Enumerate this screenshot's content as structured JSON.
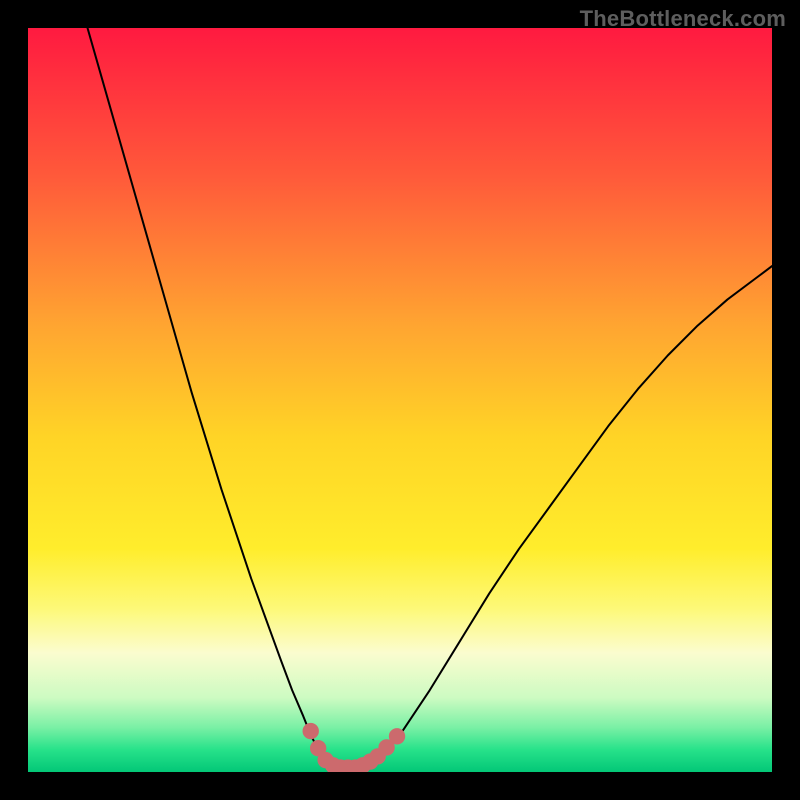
{
  "watermark": "TheBottleneck.com",
  "chart_data": {
    "type": "line",
    "title": "",
    "xlabel": "",
    "ylabel": "",
    "xlim": [
      0,
      100
    ],
    "ylim": [
      0,
      100
    ],
    "grid": false,
    "legend": false,
    "background_gradient": {
      "direction": "vertical",
      "stops": [
        {
          "pos": 0.0,
          "color": "#ff1a40"
        },
        {
          "pos": 0.2,
          "color": "#ff5a3a"
        },
        {
          "pos": 0.4,
          "color": "#ffa531"
        },
        {
          "pos": 0.55,
          "color": "#ffd426"
        },
        {
          "pos": 0.7,
          "color": "#ffed2c"
        },
        {
          "pos": 0.78,
          "color": "#fdf978"
        },
        {
          "pos": 0.84,
          "color": "#fbfccf"
        },
        {
          "pos": 0.9,
          "color": "#cdfbc2"
        },
        {
          "pos": 0.94,
          "color": "#7af0a5"
        },
        {
          "pos": 0.97,
          "color": "#27e28a"
        },
        {
          "pos": 1.0,
          "color": "#03c777"
        }
      ]
    },
    "series": [
      {
        "name": "left-curve",
        "color": "#000000",
        "x": [
          8,
          10,
          12,
          14,
          16,
          18,
          20,
          22,
          24,
          26,
          28,
          30,
          32,
          34,
          35.5,
          37,
          38,
          39,
          40
        ],
        "y": [
          100,
          93,
          86,
          79,
          72,
          65,
          58,
          51,
          44.5,
          38,
          32,
          26,
          20.5,
          15,
          11,
          7.5,
          5,
          3,
          1.5
        ]
      },
      {
        "name": "valley-floor",
        "color": "#000000",
        "x": [
          40,
          41,
          42,
          43,
          44,
          45,
          46,
          47
        ],
        "y": [
          1.5,
          0.8,
          0.5,
          0.5,
          0.5,
          0.8,
          1.3,
          2.0
        ]
      },
      {
        "name": "right-curve",
        "color": "#000000",
        "x": [
          47,
          50,
          54,
          58,
          62,
          66,
          70,
          74,
          78,
          82,
          86,
          90,
          94,
          98,
          100
        ],
        "y": [
          2.0,
          5,
          11,
          17.5,
          24,
          30,
          35.5,
          41,
          46.5,
          51.5,
          56,
          60,
          63.5,
          66.5,
          68
        ]
      }
    ],
    "markers": {
      "name": "valley-markers",
      "color": "#cc6a6d",
      "radius": 1.1,
      "points": [
        {
          "x": 38.0,
          "y": 5.5
        },
        {
          "x": 39.0,
          "y": 3.2
        },
        {
          "x": 40.0,
          "y": 1.6
        },
        {
          "x": 41.0,
          "y": 0.9
        },
        {
          "x": 42.0,
          "y": 0.6
        },
        {
          "x": 43.0,
          "y": 0.6
        },
        {
          "x": 44.0,
          "y": 0.6
        },
        {
          "x": 45.0,
          "y": 0.9
        },
        {
          "x": 46.0,
          "y": 1.4
        },
        {
          "x": 47.0,
          "y": 2.1
        },
        {
          "x": 48.2,
          "y": 3.3
        },
        {
          "x": 49.6,
          "y": 4.8
        }
      ]
    }
  }
}
